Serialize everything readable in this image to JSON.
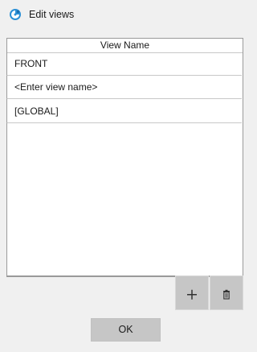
{
  "window": {
    "title": "Edit views",
    "icon": "app-logo-icon"
  },
  "table": {
    "column_header": "View Name",
    "rows": [
      {
        "label": "FRONT"
      },
      {
        "label": "<Enter view name>"
      },
      {
        "label": "[GLOBAL]"
      }
    ]
  },
  "toolbar": {
    "add_icon": "plus-icon",
    "delete_icon": "trash-icon"
  },
  "footer": {
    "ok_label": "OK"
  }
}
